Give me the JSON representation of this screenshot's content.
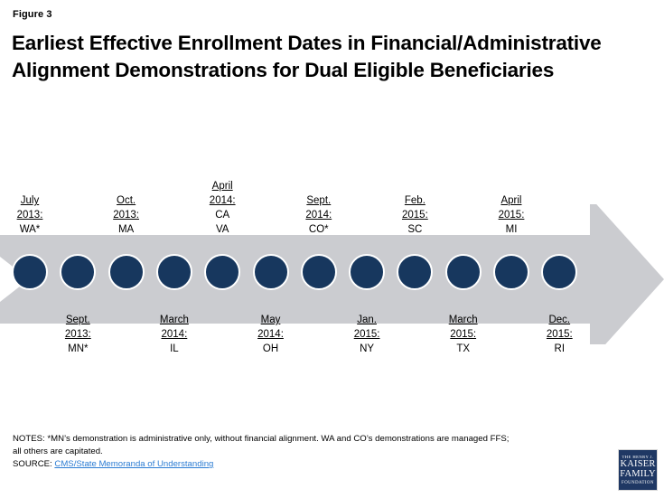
{
  "figure_label": "Figure 3",
  "title": "Earliest Effective Enrollment Dates in Financial/Administrative Alignment Demonstrations for Dual Eligible Beneficiaries",
  "colors": {
    "node_navy": "#17375e",
    "arrow_gray": "#cbccd0",
    "link_blue": "#2b7cd3",
    "logo_navy": "#1f3864"
  },
  "chart_data": {
    "type": "timeline",
    "title": "Earliest Effective Enrollment Dates in Financial/Administrative Alignment Demonstrations for Dual Eligible Beneficiaries",
    "node_count": 12,
    "events": [
      {
        "index": 1,
        "position": "above",
        "date": "July 2013:",
        "date_line1": "July",
        "date_line2": "2013:",
        "states": [
          "WA*"
        ]
      },
      {
        "index": 2,
        "position": "below",
        "date": "Sept. 2013:",
        "date_line1": "Sept.",
        "date_line2": "2013:",
        "states": [
          "MN*"
        ]
      },
      {
        "index": 3,
        "position": "above",
        "date": "Oct. 2013:",
        "date_line1": "Oct.",
        "date_line2": "2013:",
        "states": [
          "MA"
        ]
      },
      {
        "index": 4,
        "position": "below",
        "date": "March 2014:",
        "date_line1": "March",
        "date_line2": "2014:",
        "states": [
          "IL"
        ]
      },
      {
        "index": 5,
        "position": "above",
        "date": "April 2014:",
        "date_line1": "April",
        "date_line2": "2014:",
        "states": [
          "CA",
          "VA"
        ]
      },
      {
        "index": 6,
        "position": "below",
        "date": "May 2014:",
        "date_line1": "May",
        "date_line2": "2014:",
        "states": [
          "OH"
        ]
      },
      {
        "index": 7,
        "position": "above",
        "date": "Sept. 2014:",
        "date_line1": "Sept.",
        "date_line2": "2014:",
        "states": [
          "CO*"
        ]
      },
      {
        "index": 8,
        "position": "below",
        "date": "Jan. 2015:",
        "date_line1": "Jan.",
        "date_line2": "2015:",
        "states": [
          "NY"
        ]
      },
      {
        "index": 9,
        "position": "above",
        "date": "Feb. 2015:",
        "date_line1": "Feb.",
        "date_line2": "2015:",
        "states": [
          "SC"
        ]
      },
      {
        "index": 10,
        "position": "below",
        "date": "March 2015:",
        "date_line1": "March",
        "date_line2": "2015:",
        "states": [
          "TX"
        ]
      },
      {
        "index": 11,
        "position": "above",
        "date": "April 2015:",
        "date_line1": "April",
        "date_line2": "2015:",
        "states": [
          "MI"
        ]
      },
      {
        "index": 12,
        "position": "below",
        "date": "Dec. 2015:",
        "date_line1": "Dec.",
        "date_line2": "2015:",
        "states": [
          "RI"
        ]
      }
    ]
  },
  "footer": {
    "notes_line1": "NOTES:  *MN’s demonstration is administrative  only, without financial alignment.  WA and CO’s demonstrations are managed FFS;",
    "notes_line2": "all others are capitated.",
    "source_prefix": "SOURCE:",
    "source_link": "CMS/State Memoranda of Understanding"
  },
  "logo": {
    "line1": "THE HENRY J.",
    "line2": "KAISER",
    "line3": "FAMILY",
    "line4": "FOUNDATION"
  }
}
